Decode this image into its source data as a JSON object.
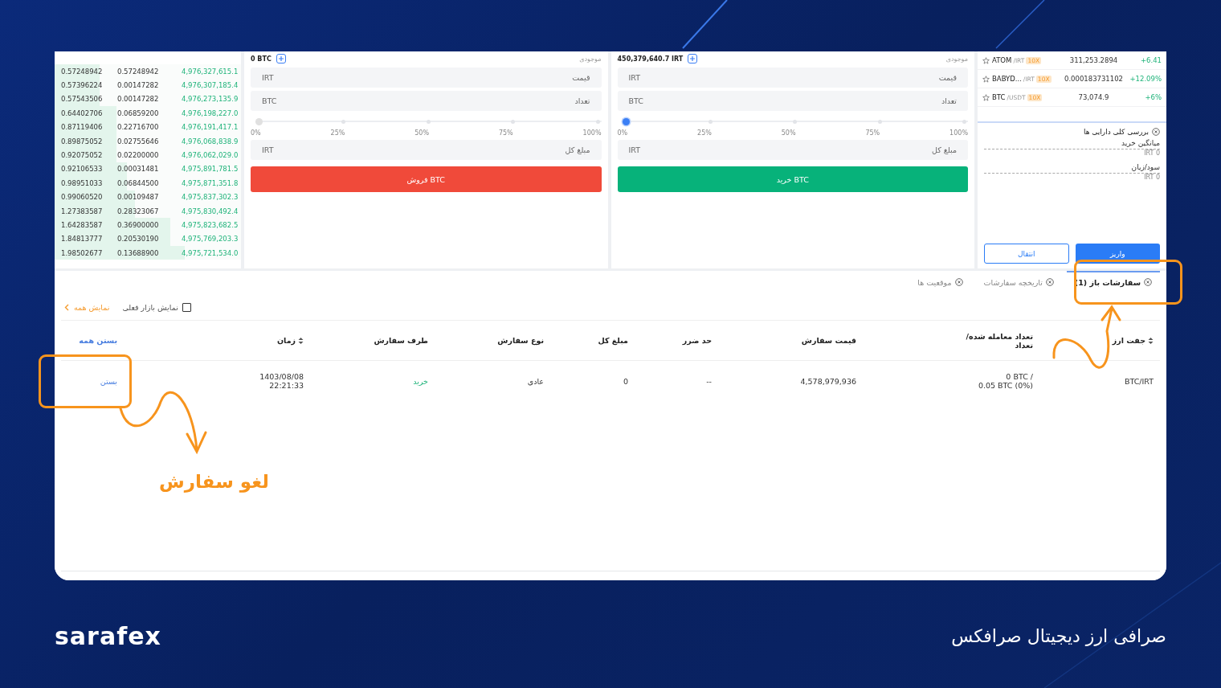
{
  "order_book": {
    "rows": [
      {
        "amount": "0.57248942",
        "volume": "0.57248942",
        "price": "4,976,327,615.1",
        "level": 0.24
      },
      {
        "amount": "0.57396224",
        "volume": "0.00147282",
        "price": "4,976,307,185.4",
        "level": 0.24
      },
      {
        "amount": "0.57543506",
        "volume": "0.00147282",
        "price": "4,976,273,135.9",
        "level": 0.24
      },
      {
        "amount": "0.64402706",
        "volume": "0.06859200",
        "price": "4,976,198,227.0",
        "level": 0.33
      },
      {
        "amount": "0.87119406",
        "volume": "0.22716700",
        "price": "4,976,191,417.1",
        "level": 0.33
      },
      {
        "amount": "0.89875052",
        "volume": "0.02755646",
        "price": "4,976,068,838.9",
        "level": 0.33
      },
      {
        "amount": "0.92075052",
        "volume": "0.02200000",
        "price": "4,976,062,029.0",
        "level": 0.33
      },
      {
        "amount": "0.92106533",
        "volume": "0.00031481",
        "price": "4,975,891,781.5",
        "level": 0.39
      },
      {
        "amount": "0.98951033",
        "volume": "0.06844500",
        "price": "4,975,871,351.8",
        "level": 0.39
      },
      {
        "amount": "0.99060520",
        "volume": "0.00109487",
        "price": "4,975,837,302.3",
        "level": 0.43
      },
      {
        "amount": "1.27383587",
        "volume": "0.28323067",
        "price": "4,975,830,492.4",
        "level": 0.43
      },
      {
        "amount": "1.64283587",
        "volume": "0.36900000",
        "price": "4,975,823,682.5",
        "level": 0.62
      },
      {
        "amount": "1.84813777",
        "volume": "0.20530190",
        "price": "4,975,769,203.3",
        "level": 0.62
      },
      {
        "amount": "1.98502677",
        "volume": "0.13688900",
        "price": "4,975,721,534.0",
        "level": 0.7
      }
    ]
  },
  "buy_form": {
    "kind": "buy",
    "balance_label": "موجودی",
    "balance": "450,379,640.7 IRT",
    "fields": [
      {
        "label": "قیمت",
        "unit": "IRT"
      },
      {
        "label": "تعداد",
        "unit": "BTC"
      }
    ],
    "slider": {
      "level": 0,
      "active": true,
      "marks": [
        "0%",
        "25%",
        "50%",
        "75%",
        "100%"
      ]
    },
    "total": {
      "label": "مبلغ کل",
      "unit": "IRT"
    },
    "button": "خرید BTC"
  },
  "sell_form": {
    "kind": "sell",
    "balance_label": "موجودی",
    "balance": "0 BTC",
    "fields": [
      {
        "label": "قیمت",
        "unit": "IRT"
      },
      {
        "label": "تعداد",
        "unit": "BTC"
      }
    ],
    "slider": {
      "level": 0,
      "active": false,
      "marks": [
        "0%",
        "25%",
        "50%",
        "75%",
        "100%"
      ]
    },
    "total": {
      "label": "مبلغ کل",
      "unit": "IRT"
    },
    "button": "فروش BTC"
  },
  "markets": [
    {
      "symbol": "ATOM",
      "quote": "/IRT",
      "leverage": "10X",
      "price": "311,253.2894",
      "change": "+6.41"
    },
    {
      "symbol": "BABYD...",
      "quote": "/IRT",
      "leverage": "10X",
      "price": "0.000183731102",
      "change": "+12.09%"
    },
    {
      "symbol": "BTC",
      "quote": "/USDT",
      "leverage": "10X",
      "price": "73,074.9",
      "change": "+6%"
    }
  ],
  "assets": {
    "title": "بررسی کلی دارایی ها",
    "items": [
      {
        "label": "میانگین خرید",
        "value": "0 IRT"
      },
      {
        "label": "سود/زیان",
        "value": "0 IRT"
      }
    ],
    "buttons": [
      {
        "label": "واریز",
        "kind": "primary"
      },
      {
        "label": "انتقال",
        "kind": "outline"
      }
    ]
  },
  "tabs": [
    {
      "label": "سفارشات باز (1)",
      "selected": true
    },
    {
      "label": "تاریخچه سفارشات",
      "selected": false
    },
    {
      "label": "موقعیت ها",
      "selected": false
    }
  ],
  "filter": {
    "checkbox": {
      "label": "نمایش بازار فعلی",
      "checked": false
    },
    "show_all": "نمایش همه"
  },
  "table": {
    "columns": [
      {
        "label": "جفت ارز",
        "sortable": true
      },
      {
        "label": "تعداد معامله شده/ تعداد",
        "sortable": false
      },
      {
        "label": "قیمت سفارش",
        "sortable": false
      },
      {
        "label": "حد ضرر",
        "sortable": false
      },
      {
        "label": "مبلغ کل",
        "sortable": false
      },
      {
        "label": "نوع سفارش",
        "sortable": false
      },
      {
        "label": "طرف سفارش",
        "sortable": false
      },
      {
        "label": "زمان",
        "sortable": true
      }
    ],
    "close_all": "بستن همه",
    "rows": [
      {
        "pair": "BTC/IRT",
        "filled": [
          "0 BTC /",
          "0.05 BTC (0%)"
        ],
        "price": "4,578,979,936",
        "stop_loss": "--",
        "total": "0",
        "type": "عادی",
        "side": "خرید",
        "time": [
          "1403/08/08",
          "22:21:33"
        ],
        "action": "بستن"
      }
    ]
  },
  "annotation": {
    "text": "لغو سفارش"
  },
  "footer": {
    "logo": "sarafex",
    "tagline": "صرافی ارز دیجیتال صرافکس"
  }
}
